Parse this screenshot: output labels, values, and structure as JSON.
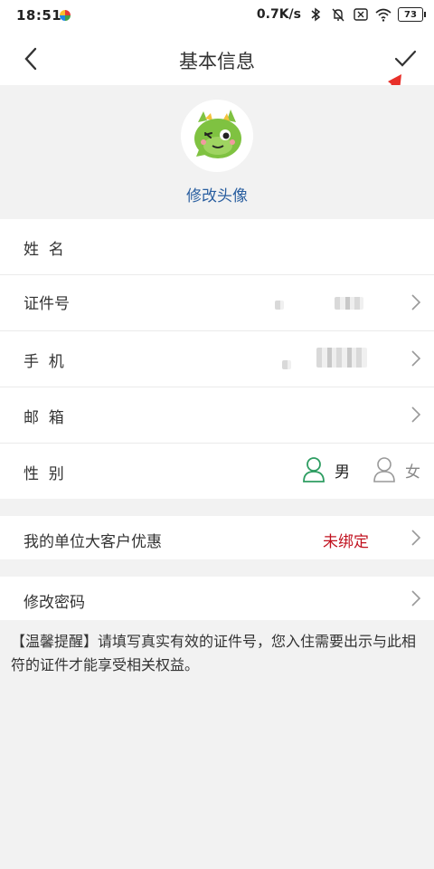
{
  "status_bar": {
    "time": "18:51",
    "network_speed": "0.7K/s",
    "battery": "73"
  },
  "header": {
    "title": "基本信息"
  },
  "avatar": {
    "change_label": "修改头像"
  },
  "form": {
    "name_label": "姓  名",
    "id_label": "证件号",
    "phone_label": "手  机",
    "email_label": "邮  箱",
    "gender_label": "性  别",
    "gender_male": "男",
    "gender_female": "女",
    "gender_selected": "男"
  },
  "corporate": {
    "label": "我的单位大客户优惠",
    "status": "未绑定",
    "status_color": "#c1121f"
  },
  "password": {
    "label": "修改密码"
  },
  "tip": {
    "text": "【温馨提醒】请填写真实有效的证件号，您入住需要出示与此相符的证件才能享受相关权益。"
  },
  "colors": {
    "accent_green": "#2e9d62",
    "link_blue": "#2a5fa0",
    "annotation_red": "#e8302a"
  }
}
